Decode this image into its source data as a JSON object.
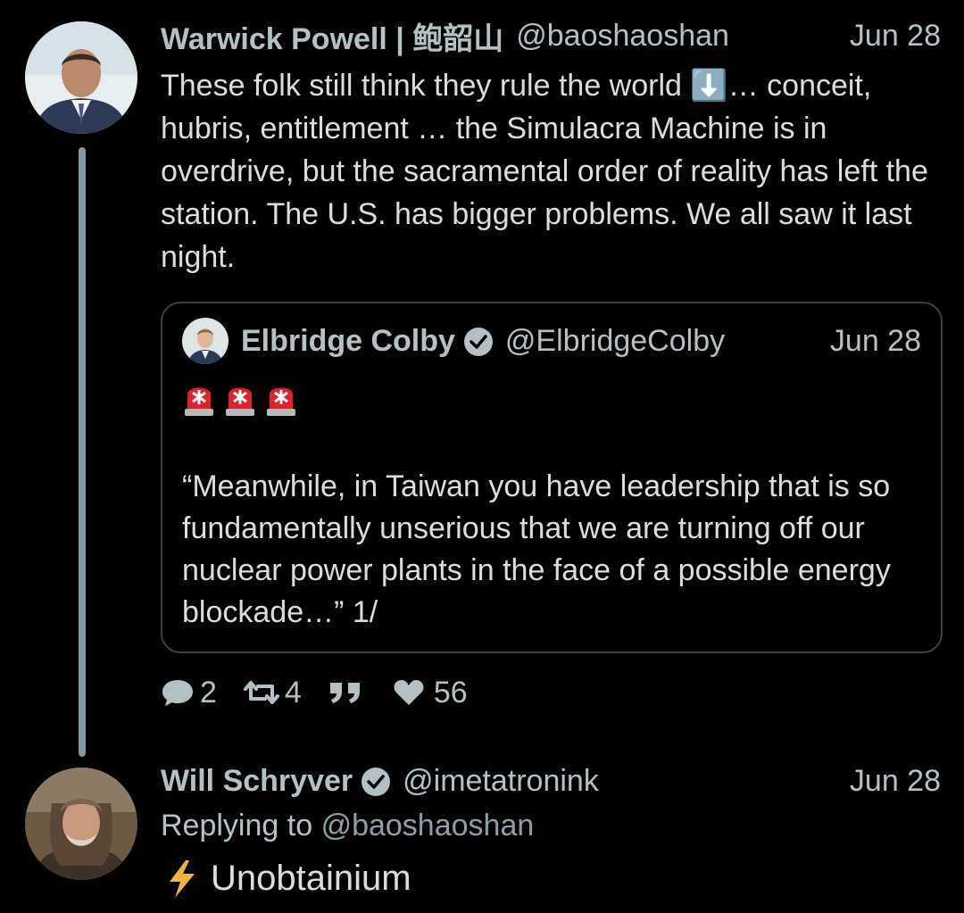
{
  "tweet1": {
    "name": "Warwick Powell | 鲍韶山",
    "handle": "@baoshaoshan",
    "date": "Jun 28",
    "text": "These folk still think they rule the world ⬇️… conceit, hubris, entitlement … the Simulacra Machine is in overdrive, but the sacramental order of reality has left the station. The U.S. has bigger problems. We all saw it last night.",
    "avatar_icon": "person-avatar"
  },
  "quote": {
    "name": "Elbridge Colby",
    "handle": "@ElbridgeColby",
    "date": "Jun 28",
    "emojis": [
      "🚨",
      "🚨",
      "🚨"
    ],
    "text": "“Meanwhile, in Taiwan you have leadership that is so fundamentally unserious that we are turning off our nuclear power plants in the face of a possible energy blockade…” 1/",
    "verified_icon": "verified-icon"
  },
  "actions": {
    "replies": "2",
    "retweets": "4",
    "likes": "56",
    "icons": [
      "reply-icon",
      "retweet-icon",
      "quote-icon",
      "heart-icon"
    ]
  },
  "tweet2": {
    "name": "Will Schryver",
    "handle": "@imetatronink",
    "date": "Jun 28",
    "replying_prefix": "Replying to",
    "replying_handle": "@baoshaoshan",
    "text": "Unobtainium",
    "emoji": "⚡",
    "verified_icon": "verified-icon"
  },
  "colors": {
    "background": "#000000",
    "text": "#d9dde0",
    "muted": "#b3c0c4",
    "thread_line": "#7f9aa0"
  }
}
